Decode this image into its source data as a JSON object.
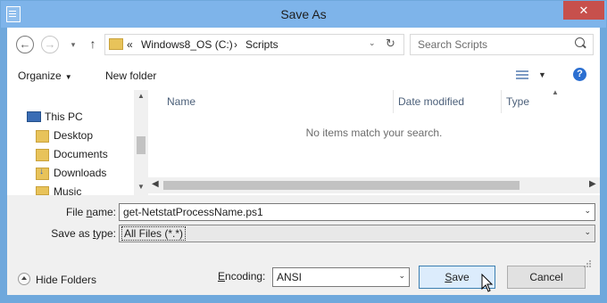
{
  "window": {
    "title": "Save As",
    "close_symbol": "✕"
  },
  "nav": {
    "back": "←",
    "forward": "→",
    "up": "↑",
    "recent_caret": "▾"
  },
  "address": {
    "chevrons": "«",
    "crumbs": [
      "Windows8_OS (C:)",
      "Scripts"
    ],
    "separator": "›",
    "dropdown": "⌄",
    "refresh": "↻"
  },
  "search": {
    "placeholder": "Search Scripts"
  },
  "toolbar": {
    "organize": "Organize",
    "new_folder": "New folder",
    "help": "?"
  },
  "sidebar": {
    "items": [
      {
        "label": "This PC",
        "icon": "computer-icon"
      },
      {
        "label": "Desktop",
        "icon": "folder-icon"
      },
      {
        "label": "Documents",
        "icon": "folder-icon"
      },
      {
        "label": "Downloads",
        "icon": "download-folder-icon"
      },
      {
        "label": "Music",
        "icon": "folder-icon"
      }
    ]
  },
  "filelist": {
    "columns": [
      "Name",
      "Date modified",
      "Type"
    ],
    "empty_message": "No items match your search."
  },
  "form": {
    "filename_label_prefix": "File ",
    "filename_label_access": "n",
    "filename_label_suffix": "ame:",
    "filename_value": "get-NetstatProcessName.ps1",
    "savetype_label_prefix": "Save as ",
    "savetype_label_access": "t",
    "savetype_label_suffix": "ype:",
    "savetype_value": "All Files  (*.*)",
    "encoding_label_access": "E",
    "encoding_label_suffix": "ncoding:",
    "encoding_value": "ANSI"
  },
  "buttons": {
    "hide_folders": "Hide Folders",
    "save_access": "S",
    "save_suffix": "ave",
    "cancel": "Cancel"
  },
  "colors": {
    "titlebar": "#7eb4ea",
    "accent_button": "#dcecfc",
    "close": "#c7504c"
  }
}
